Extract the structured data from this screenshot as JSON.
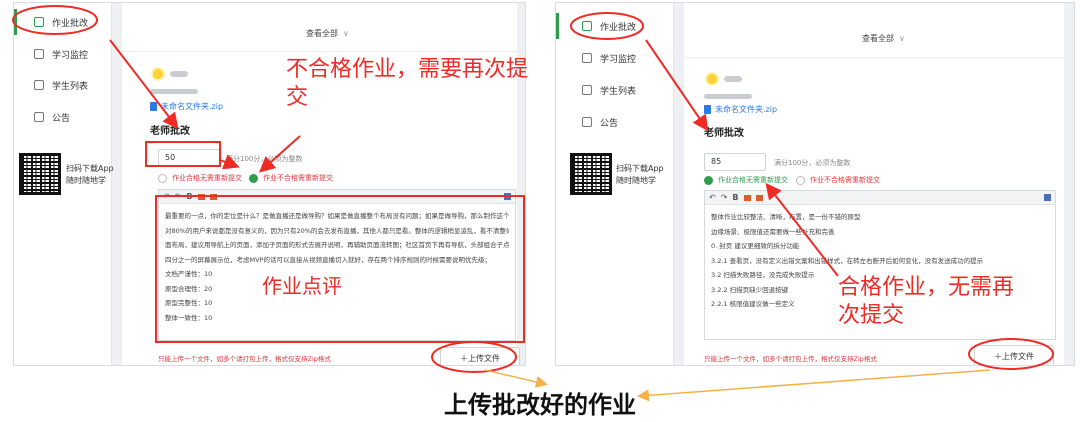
{
  "sidebar": {
    "items": [
      {
        "label": "作业批改",
        "icon": "homework-edit-icon"
      },
      {
        "label": "学习监控",
        "icon": "monitor-icon"
      },
      {
        "label": "学生列表",
        "icon": "student-list-icon"
      },
      {
        "label": "公告",
        "icon": "announcement-icon"
      }
    ],
    "qr_text_line1": "扫码下载App",
    "qr_text_line2": "随时随地学"
  },
  "left": {
    "view_all": "查看全部",
    "file_name": "未命名文件夹.zip",
    "section_title": "老师批改",
    "score_value": "50",
    "score_hint": "满分100分，必须为整数",
    "radio_pass": "作业合格无需重新提交",
    "radio_fail": "作业不合格需重新提交",
    "comment_lines": [
      "最重要的一点，你的定位是什么？是做直播还是做导购？如果是做直播整个布局没有问题；如果是做导购，那么制作这个东西",
      "对80%的用户来说都是没有意义的，因为只有20%的会去发布直播，其他人都只是看。整体的逻辑稍显凌乱，看不清整体的页",
      "面布局，建议用导航上的页面，添加子页面的形式去展开说明，再辅助页面流转图；社区首页下再有导航，头部组合子点击了",
      "四分之一的屏幕展示位，考虑MVP的话可以直接从视频直播切入就好，存在两个排序规则的时候需要说明优先级；",
      "文档严谨性：10",
      "原型合理性：20",
      "原型完整性：10",
      "整体一致性：10"
    ],
    "upload_note": "只能上传一个文件，如多个请打包上传，格式仅支持Zip格式",
    "upload_button": "上传文件"
  },
  "right": {
    "view_all": "查看全部",
    "file_name": "未命名文件夹.zip",
    "section_title": "老师批改",
    "score_value": "85",
    "score_hint": "满分100分，必须为整数",
    "radio_pass": "作业合格无需重新提交",
    "radio_fail": "作业不合格需重新提交",
    "comment_lines": [
      "整体作业比较整洁、清晰，布置，是一份不错的原型",
      "边缘场景、极限值还需要做一些补充和完善",
      "0. 封页 建议更细致的拆分功能",
      "3.2.1 查看页，没有定义出错文案和出错样式，在转左右断开后如何变化，没有发送成功的提示",
      "3.2 扫描失败路径，没完成失败提示",
      "3.2.2 扫描页缺少回退按键",
      "2.2.1 核限值建议做一些定义"
    ],
    "upload_note": "只能上传一个文件，如多个请打包上传，格式仅支持Zip格式",
    "upload_button": "上传文件"
  },
  "annotations": {
    "fail_note": "不合格作业，需要再次提交",
    "comment_note": "作业点评",
    "pass_note": "合格作业，无需再次提交",
    "caption": "上传批改好的作业"
  },
  "colors": {
    "accent_green": "#2e9e4e",
    "annotation_red": "#ef2b26",
    "link_blue": "#2a7ae2",
    "arrow_orange": "#f5b049"
  }
}
